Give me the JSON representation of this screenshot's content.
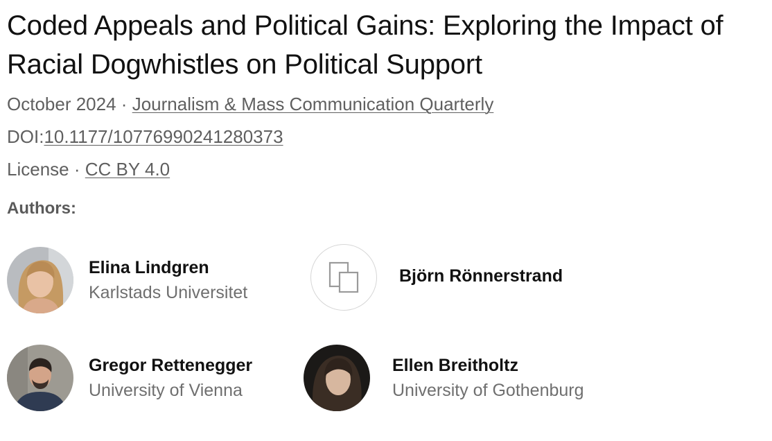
{
  "title": "Coded Appeals and Political Gains: Exploring the Impact of Racial Dogwhistles on Political Support",
  "date": "October 2024",
  "separator": "·",
  "journal": "Journalism & Mass Communication Quarterly",
  "doi_label": "DOI:",
  "doi": "10.1177/10776990241280373",
  "license_label": "License",
  "license": "CC BY 4.0",
  "authors_heading": "Authors:",
  "authors": [
    {
      "name": "Elina Lindgren",
      "affiliation": "Karlstads Universitet",
      "avatar": "photo"
    },
    {
      "name": "Björn Rönnerstrand",
      "affiliation": "",
      "avatar": "placeholder-icon"
    },
    {
      "name": "Gregor Rettenegger",
      "affiliation": "University of Vienna",
      "avatar": "photo"
    },
    {
      "name": "Ellen Breitholtz",
      "affiliation": "University of Gothenburg",
      "avatar": "photo"
    }
  ],
  "colors": {
    "text": "#111111",
    "meta": "#5f5f5f",
    "affiliation": "#6f6f6f",
    "placeholder_border": "#d6d6d6"
  }
}
